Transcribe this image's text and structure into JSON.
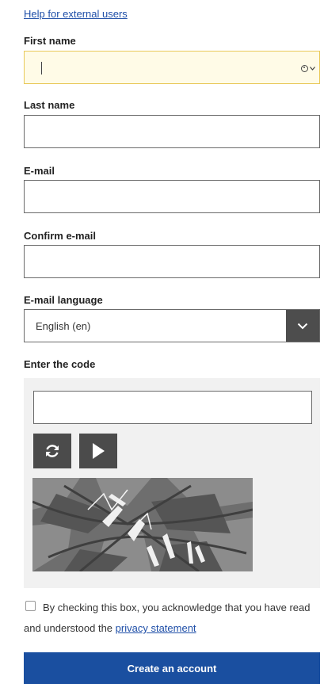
{
  "help_link": "Help for external users",
  "fields": {
    "first_name": {
      "label": "First name",
      "value": ""
    },
    "last_name": {
      "label": "Last name",
      "value": ""
    },
    "email": {
      "label": "E-mail",
      "value": ""
    },
    "confirm_email": {
      "label": "Confirm e-mail",
      "value": ""
    }
  },
  "email_language": {
    "label": "E-mail language",
    "selected": "English (en)"
  },
  "captcha": {
    "label": "Enter the code",
    "value": "",
    "refresh_icon": "refresh-icon",
    "audio_icon": "play-icon"
  },
  "consent": {
    "text": "By checking this box, you acknowledge that you have read and understood the",
    "link": "privacy statement",
    "checked": false
  },
  "submit_label": "Create an account",
  "colors": {
    "link": "#1f4fa8",
    "focus_border": "#e9c95a",
    "focus_bg": "#fffbe7",
    "button_primary": "#1a4fa0",
    "dark_control": "#4b4b4b"
  }
}
